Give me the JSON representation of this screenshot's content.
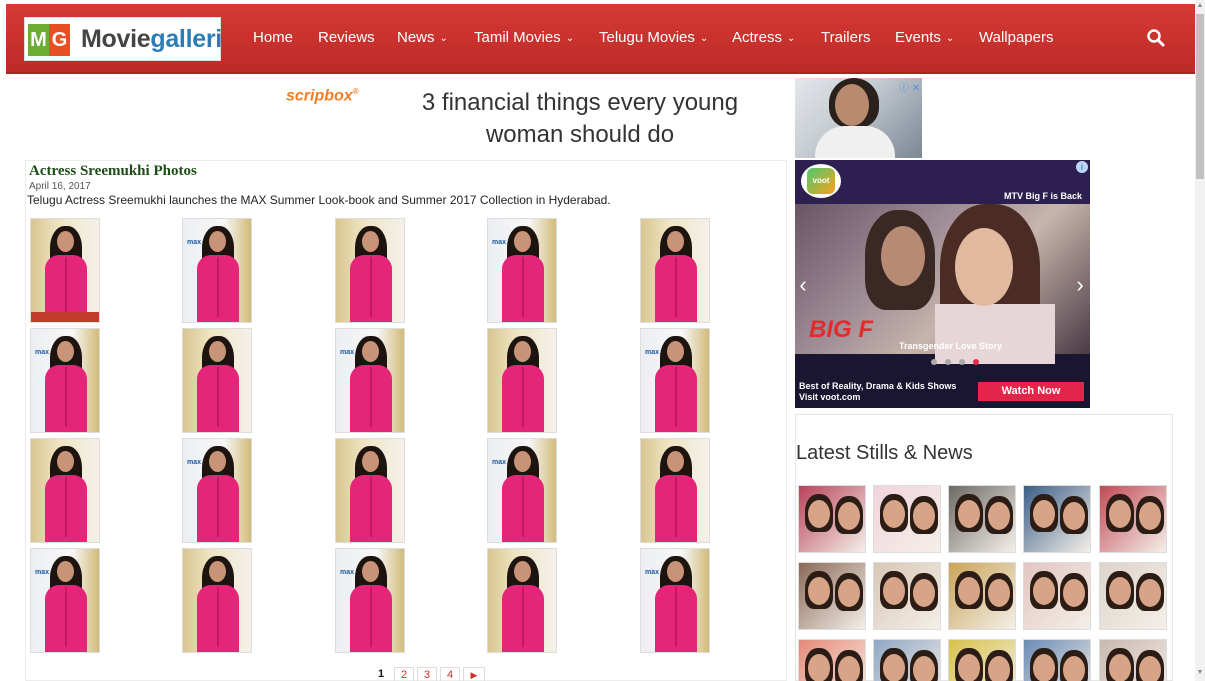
{
  "colors": {
    "header": "#c8312d",
    "brand_green": "#6cae34",
    "brand_orange": "#e45124",
    "title_green": "#1d4e17",
    "ad_orange": "#f47c22",
    "voot_cta": "#e3254a"
  },
  "logo": {
    "m": "M",
    "g": "G",
    "text_dark": "Movie",
    "text_accent": "galleri"
  },
  "nav": [
    {
      "label": "Home",
      "dropdown": false
    },
    {
      "label": "Reviews",
      "dropdown": false
    },
    {
      "label": "News",
      "dropdown": true
    },
    {
      "label": "Tamil Movies",
      "dropdown": true
    },
    {
      "label": "Telugu Movies",
      "dropdown": true
    },
    {
      "label": "Actress",
      "dropdown": true
    },
    {
      "label": "Trailers",
      "dropdown": false
    },
    {
      "label": "Events",
      "dropdown": true
    },
    {
      "label": "Wallpapers",
      "dropdown": false
    }
  ],
  "nav_chevron": "⌄",
  "icons": {
    "search": "search-icon",
    "ad_info": "info-icon",
    "ad_close": "close-icon"
  },
  "ad_banner": {
    "brand": "scripbox",
    "brand_mark": "®",
    "headline": "3 financial things every young woman should do",
    "ad_marks": "ⓘ ✕"
  },
  "article": {
    "title": "Actress Sreemukhi Photos",
    "date": "April 16, 2017",
    "description": "Telugu Actress Sreemukhi launches the MAX Summer Look-book and Summer 2017 Collection in Hyderabad.",
    "gallery_rows": 4,
    "gallery_cols": 5
  },
  "pagination": {
    "current": "1",
    "pages": [
      "2",
      "3",
      "4"
    ],
    "next": "▶"
  },
  "voot_ad": {
    "logo": "voot",
    "tagline": "MTV Big F is Back",
    "info": "i",
    "show": "BIG F",
    "caption": "Transgender Love Story",
    "prev_arrow": "‹",
    "next_arrow": "›",
    "dots": 4,
    "active_dot": 3,
    "bottom_line1": "Best of Reality, Drama & Kids Shows",
    "bottom_line2": "Visit voot.com",
    "cta": "Watch Now"
  },
  "latest": {
    "title": "Latest Stills & News"
  },
  "scrollbar": {
    "up": "▲",
    "down": "▼"
  }
}
